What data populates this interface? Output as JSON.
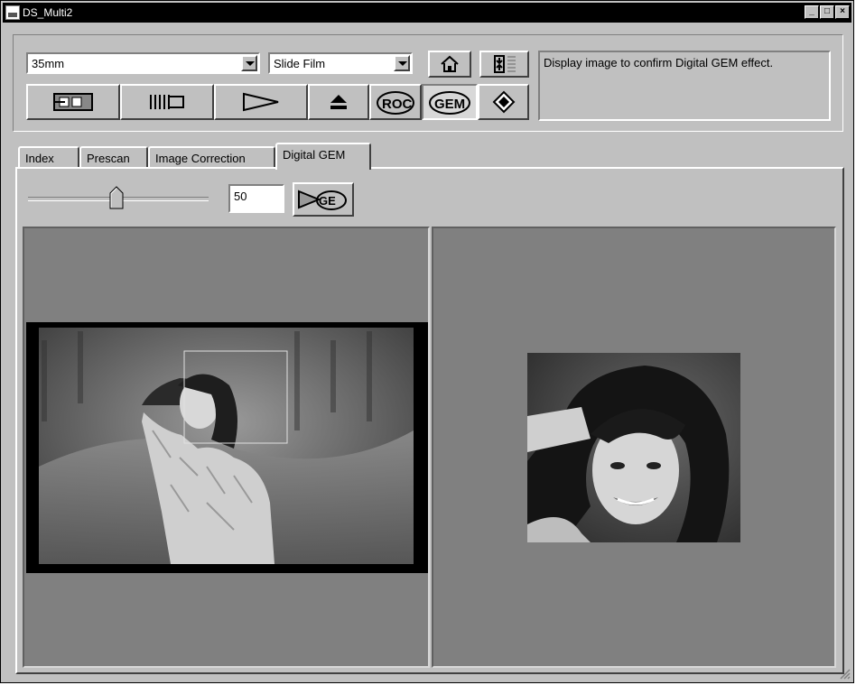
{
  "window": {
    "title": "DS_Multi2"
  },
  "toolbar": {
    "film_format": "35mm",
    "film_type": "Slide Film",
    "message": "Display image to confirm Digital GEM effect."
  },
  "tabs": [
    {
      "label": "Index"
    },
    {
      "label": "Prescan"
    },
    {
      "label": "Image Correction"
    },
    {
      "label": "Digital GEM"
    }
  ],
  "gem": {
    "value": "50",
    "slider_fraction": 0.5
  },
  "colors": {
    "face": "#c0c0c0",
    "pane": "#808080",
    "titlebar": "#000000"
  }
}
